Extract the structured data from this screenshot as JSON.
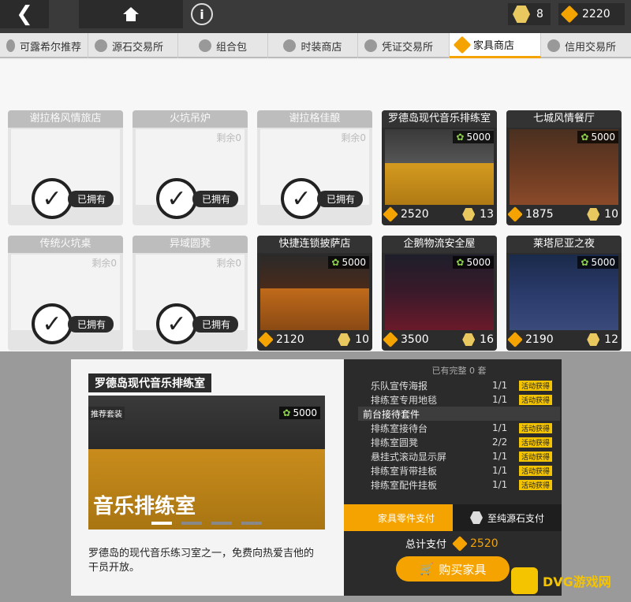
{
  "topbar": {
    "currency1": "8",
    "currency2": "2220"
  },
  "tabs": [
    {
      "label": "可露希尔推荐"
    },
    {
      "label": "源石交易所"
    },
    {
      "label": "组合包"
    },
    {
      "label": "时装商店"
    },
    {
      "label": "凭证交易所"
    },
    {
      "label": "家具商店",
      "active": true
    },
    {
      "label": "信用交易所"
    }
  ],
  "owned_label": "已拥有",
  "cards": [
    {
      "title": "谢拉格风情旅店",
      "owned": true
    },
    {
      "title": "火坑吊炉",
      "owned": true,
      "badge": "剩余0"
    },
    {
      "title": "谢拉格佳酿",
      "owned": true,
      "badge": "剩余0"
    },
    {
      "title": "罗德岛现代音乐排练室",
      "owned": false,
      "badge": "5000",
      "price": "2520",
      "token": "13"
    },
    {
      "title": "七城风情餐厅",
      "owned": false,
      "badge": "5000",
      "price": "1875",
      "token": "10"
    },
    {
      "title": "传统火坑桌",
      "owned": true,
      "badge": "剩余0"
    },
    {
      "title": "异域圆凳",
      "owned": true,
      "badge": "剩余0"
    },
    {
      "title": "快捷连锁披萨店",
      "owned": false,
      "badge": "5000",
      "price": "2120",
      "token": "10"
    },
    {
      "title": "企鹅物流安全屋",
      "owned": false,
      "badge": "5000",
      "price": "3500",
      "token": "16"
    },
    {
      "title": "莱塔尼亚之夜",
      "owned": false,
      "badge": "5000",
      "price": "2190",
      "token": "12"
    }
  ],
  "detail": {
    "title": "罗德岛现代音乐排练室",
    "badge": "5000",
    "preview_text": "音乐排练室",
    "preview_tag": "推荐套装",
    "description": "罗德岛的现代音乐练习室之一，免费向热爱吉他的干员开放。",
    "summary": "已有完整 0 套",
    "items": [
      {
        "name": "乐队宣传海报",
        "count": "1/1",
        "tag": "活动获得"
      },
      {
        "name": "排练室专用地毯",
        "count": "1/1",
        "tag": "活动获得"
      },
      {
        "name": "前台接待套件",
        "set": true
      },
      {
        "name": "排练室接待台",
        "count": "1/1",
        "tag": "活动获得"
      },
      {
        "name": "排练室圆凳",
        "count": "2/2",
        "tag": "活动获得"
      },
      {
        "name": "悬挂式滚动显示屏",
        "count": "1/1",
        "tag": "活动获得"
      },
      {
        "name": "排练室背带挂板",
        "count": "1/1",
        "tag": "活动获得"
      },
      {
        "name": "排练室配件挂板",
        "count": "1/1",
        "tag": "活动获得"
      }
    ],
    "pay_parts": "家具零件支付",
    "pay_stone": "至纯源石支付",
    "total_label": "总计支付",
    "total_value": "2520",
    "buy": "购买家具"
  },
  "watermark": {
    "text": "DVG游戏网"
  }
}
